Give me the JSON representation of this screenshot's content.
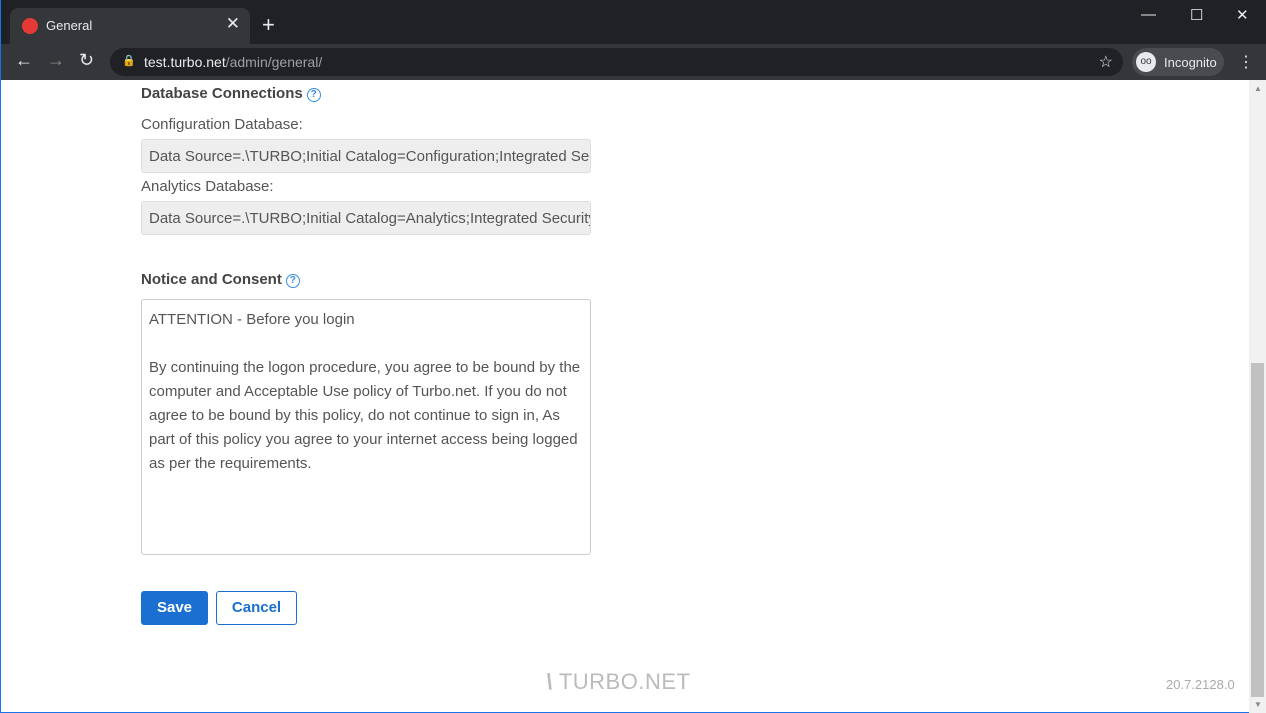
{
  "browser": {
    "tab_title": "General",
    "url_host": "test.turbo.net",
    "url_path": "/admin/general/",
    "incognito_label": "Incognito"
  },
  "db": {
    "heading": "Database Connections",
    "config_label": "Configuration Database:",
    "config_value": "Data Source=.\\TURBO;Initial Catalog=Configuration;Integrated Security=True",
    "analytics_label": "Analytics Database:",
    "analytics_value": "Data Source=.\\TURBO;Initial Catalog=Analytics;Integrated Security=True"
  },
  "notice": {
    "heading": "Notice and Consent",
    "text": "ATTENTION - Before you login\n\nBy continuing the logon procedure, you agree to be bound by the computer and Acceptable Use policy of Turbo.net. If you do not agree to be bound by this policy, do not continue to sign in, As part of this policy you agree to your internet access being logged as per the requirements."
  },
  "actions": {
    "save": "Save",
    "cancel": "Cancel"
  },
  "footer": {
    "logo": "TURBO.NET",
    "version": "20.7.2128.0"
  }
}
